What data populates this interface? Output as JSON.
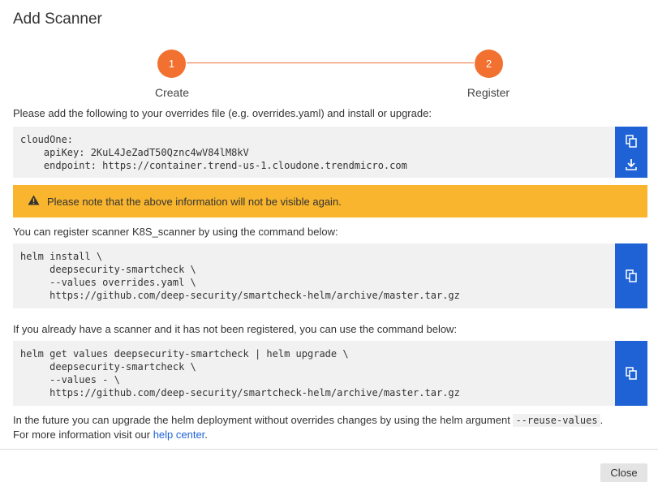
{
  "dialog": {
    "title": "Add Scanner",
    "close_label": "Close"
  },
  "stepper": {
    "steps": [
      {
        "number": "1",
        "label": "Create"
      },
      {
        "number": "2",
        "label": "Register"
      }
    ],
    "accent_color": "#f27130"
  },
  "overrides": {
    "intro": "Please add the following to your overrides file (e.g. overrides.yaml) and install or upgrade:",
    "code": "cloudOne:\n    apiKey: 2KuL4JeZadT50Qznc4wV84lM8kV\n    endpoint: https://container.trend-us-1.cloudone.trendmicro.com",
    "copy_icon": "copy-icon",
    "download_icon": "download-icon"
  },
  "warning": {
    "text": "Please note that the above information will not be visible again.",
    "icon": "warning-icon",
    "color": "#f9b52d"
  },
  "register": {
    "intro": "You can register scanner K8S_scanner by using the command below:",
    "code": "helm install \\\n     deepsecurity-smartcheck \\\n     --values overrides.yaml \\\n     https://github.com/deep-security/smartcheck-helm/archive/master.tar.gz"
  },
  "upgrade": {
    "intro": "If you already have a scanner and it has not been registered, you can use the command below:",
    "code": "helm get values deepsecurity-smartcheck | helm upgrade \\\n     deepsecurity-smartcheck \\\n     --values - \\\n     https://github.com/deep-security/smartcheck-helm/archive/master.tar.gz"
  },
  "footer": {
    "line1_prefix": "In the future you can upgrade the helm deployment without overrides changes by using the helm argument",
    "line1_code": "--reuse-values",
    "line1_suffix": ".",
    "line2_prefix": "For more information visit our",
    "help_link": "help center",
    "line2_suffix": "."
  },
  "colors": {
    "button_blue": "#1e62d6",
    "link_blue": "#1e62d6"
  }
}
